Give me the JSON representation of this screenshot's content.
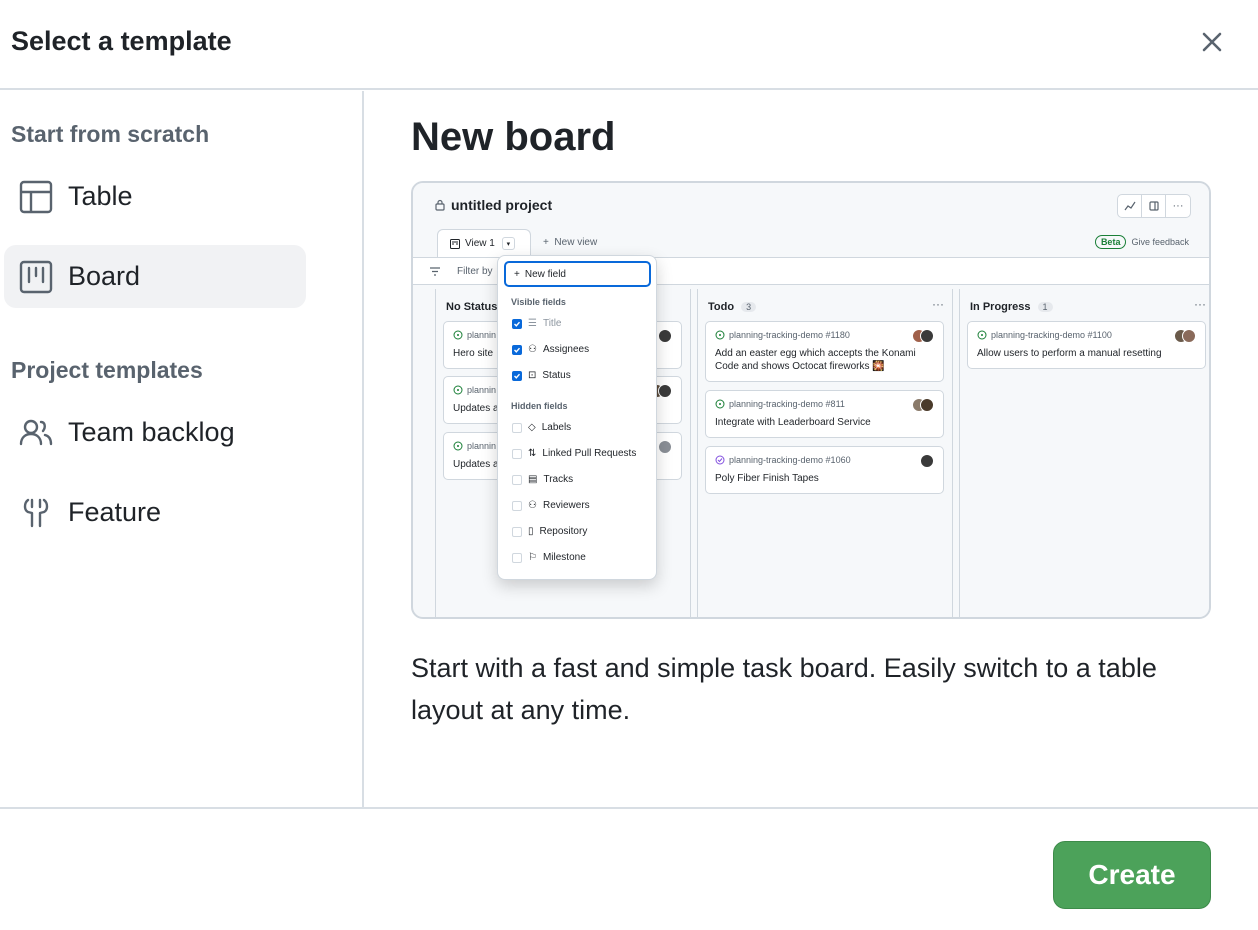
{
  "dialog": {
    "title": "Select a template",
    "close_icon": "close-icon"
  },
  "sidebar": {
    "scratch_label": "Start from scratch",
    "scratch_items": [
      {
        "label": "Table",
        "icon": "table-icon"
      },
      {
        "label": "Board",
        "icon": "board-icon",
        "selected": true
      }
    ],
    "templates_label": "Project templates",
    "template_items": [
      {
        "label": "Team backlog",
        "icon": "people-icon"
      },
      {
        "label": "Feature",
        "icon": "feature-icon"
      }
    ]
  },
  "main": {
    "title": "New board",
    "description": "Start with a fast and simple task board. Easily switch to a table layout at any time."
  },
  "preview": {
    "project_title": "untitled project",
    "view_tab": "View 1",
    "new_view": "New view",
    "beta_badge": "Beta",
    "give_feedback": "Give feedback",
    "filter_text": "Filter by",
    "dropdown": {
      "new_field": "New field",
      "visible_head": "Visible fields",
      "visible": [
        "Title",
        "Assignees",
        "Status"
      ],
      "hidden_head": "Hidden fields",
      "hidden": [
        "Labels",
        "Linked Pull Requests",
        "Tracks",
        "Reviewers",
        "Repository",
        "Milestone"
      ]
    },
    "columns": [
      {
        "name": "No Status",
        "count": "",
        "cards": [
          {
            "meta": "plannin",
            "title": "Hero site"
          },
          {
            "meta": "plannin",
            "title": "Updates a"
          },
          {
            "meta": "plannin",
            "title": "Updates a"
          }
        ]
      },
      {
        "name": "Todo",
        "count": "3",
        "cards": [
          {
            "meta": "planning-tracking-demo #1180",
            "title": "Add an easter egg which accepts the Konami Code and shows Octocat fireworks 🎇"
          },
          {
            "meta": "planning-tracking-demo #811",
            "title": "Integrate with Leaderboard Service"
          },
          {
            "meta": "planning-tracking-demo #1060",
            "title": "Poly Fiber Finish Tapes"
          }
        ]
      },
      {
        "name": "In Progress",
        "count": "1",
        "cards": [
          {
            "meta": "planning-tracking-demo #1100",
            "title": "Allow users to perform a manual resetting"
          }
        ]
      }
    ]
  },
  "footer": {
    "create_label": "Create"
  },
  "colors": {
    "primary_green": "#4ca25a",
    "accent_blue": "#0969da",
    "border": "#d0d7de"
  }
}
